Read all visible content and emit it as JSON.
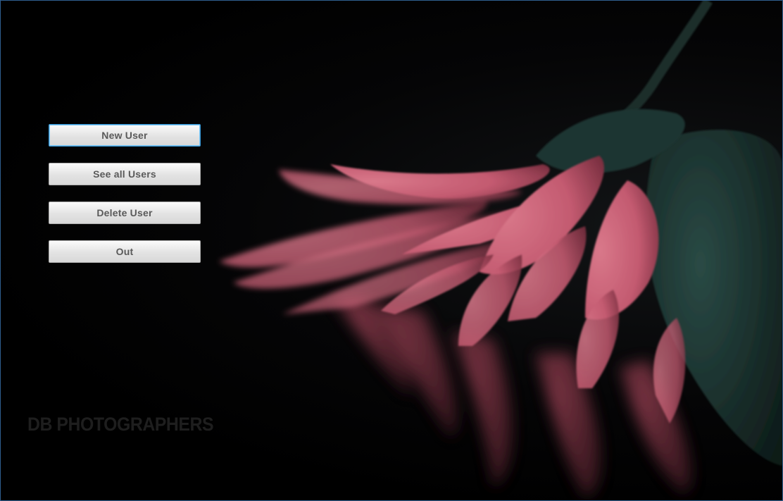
{
  "buttons": {
    "new_user": "New User",
    "see_all_users": "See all Users",
    "delete_user": "Delete User",
    "out": "Out"
  },
  "watermark": "DB PHOTOGRAPHERS",
  "colors": {
    "background": "#000000",
    "petal": "#c8566d",
    "leaf": "#1f3b37",
    "focus_border": "#3a9ad9"
  }
}
